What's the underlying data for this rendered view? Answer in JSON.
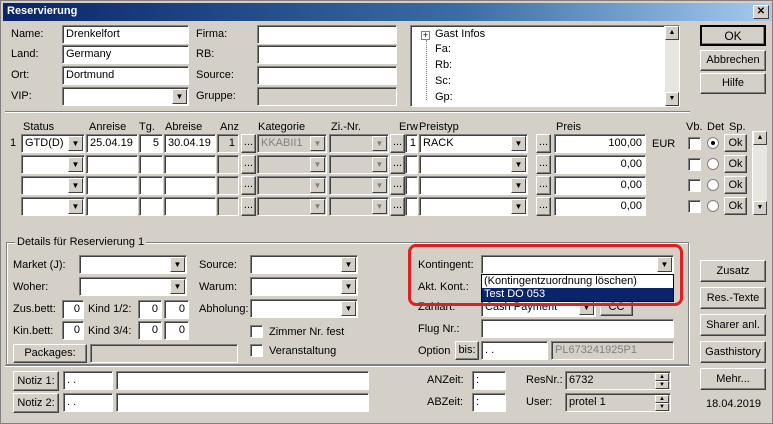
{
  "window": {
    "title": "Reservierung",
    "close_glyph": "✕"
  },
  "guest": {
    "name_label": "Name:",
    "name_value": "Drenkelfort",
    "land_label": "Land:",
    "land_value": "Germany",
    "ort_label": "Ort:",
    "ort_value": "Dortmund",
    "vip_label": "VIP:",
    "vip_value": "",
    "firma_label": "Firma:",
    "firma_value": "",
    "rb_label": "RB:",
    "rb_value": "",
    "source_label": "Source:",
    "source_value": "",
    "gruppe_label": "Gruppe:",
    "gruppe_value": ""
  },
  "guest_info_tree": {
    "root_expander": "+",
    "root_label": "Gast Infos",
    "items": [
      "Fa:",
      "Rb:",
      "Sc:",
      "Gp:"
    ]
  },
  "right_buttons": {
    "ok": "OK",
    "cancel": "Abbrechen",
    "help": "Hilfe"
  },
  "grid": {
    "headers": {
      "status": "Status",
      "anreise": "Anreise",
      "tg": "Tg.",
      "abreise": "Abreise",
      "anz": "Anz",
      "kategorie": "Kategorie",
      "zinr": "Zi.-Nr.",
      "erw": "Erw",
      "preistyp": "Preistyp",
      "preis": "Preis",
      "vb": "Vb.",
      "det": "Det",
      "sp": "Sp."
    },
    "ellipsis": "...",
    "currency": "EUR",
    "ok_label": "Ok",
    "rows": [
      {
        "num": "1",
        "status": "GTD(D)",
        "anreise": "25.04.19",
        "tg": "5",
        "abreise": "30.04.19",
        "anz": "1",
        "kategorie": "KKABII1",
        "zinr": "",
        "erw": "1",
        "preistyp": "RACK",
        "preis": "100,00",
        "currency": "EUR",
        "det": true
      },
      {
        "num": "",
        "status": "",
        "anreise": "",
        "tg": "",
        "abreise": "",
        "anz": "",
        "kategorie": "",
        "zinr": "",
        "erw": "",
        "preistyp": "",
        "preis": "0,00",
        "currency": "",
        "det": false
      },
      {
        "num": "",
        "status": "",
        "anreise": "",
        "tg": "",
        "abreise": "",
        "anz": "",
        "kategorie": "",
        "zinr": "",
        "erw": "",
        "preistyp": "",
        "preis": "0,00",
        "currency": "",
        "det": false
      },
      {
        "num": "",
        "status": "",
        "anreise": "",
        "tg": "",
        "abreise": "",
        "anz": "",
        "kategorie": "",
        "zinr": "",
        "erw": "",
        "preistyp": "",
        "preis": "0,00",
        "currency": "",
        "det": false
      }
    ]
  },
  "details": {
    "group_title": "Details für Reservierung 1",
    "market_label": "Market (J):",
    "woher_label": "Woher:",
    "zusbett_label": "Zus.bett:",
    "zusbett_value": "0",
    "kinbett_label": "Kin.bett:",
    "kinbett_value": "0",
    "kind12_label": "Kind 1/2:",
    "kind12_a": "0",
    "kind12_b": "0",
    "kind34_label": "Kind 3/4:",
    "kind34_a": "0",
    "kind34_b": "0",
    "packages_label": "Packages:",
    "source_label": "Source:",
    "warum_label": "Warum:",
    "abholung_label": "Abholung:",
    "zimmer_fest_label": "Zimmer Nr. fest",
    "veranstaltung_label": "Veranstaltung",
    "kontingent_label": "Kontingent:",
    "akt_kont_label": "Akt. Kont.:",
    "zahlart_label": "Zahlart:",
    "zahlart_value": "Cash Payment",
    "cc_label": "CC",
    "flug_label": "Flug Nr.:",
    "option_label": "Option",
    "bis_label": "bis:",
    "option_date": ".  .",
    "pl_value": "PL673241925P1"
  },
  "kontingent_dropdown": {
    "options": [
      "(Kontingentzuordnung löschen)",
      "Test DO 053"
    ],
    "selected_index": 1
  },
  "side_buttons": {
    "zusatz": "Zusatz",
    "res_texte": "Res.-Texte",
    "sharer": "Sharer anl.",
    "gasthistory": "Gasthistory",
    "mehr": "Mehr..."
  },
  "date_label": "18.04.2019",
  "notes": {
    "notiz1_label": "Notiz 1:",
    "notiz1_date": ".  .",
    "notiz2_label": "Notiz 2:",
    "notiz2_date": ".  .",
    "anzeit_label": "ANZeit:",
    "anzeit_value": ":",
    "abzeit_label": "ABZeit:",
    "abzeit_value": ":",
    "resnr_label": "ResNr.:",
    "resnr_value": "6732",
    "user_label": "User:",
    "user_value": "protel 1"
  },
  "colors": {
    "accent_highlight": "#e02020",
    "titlebar": "#0a246a",
    "selection": "#0a246a"
  }
}
